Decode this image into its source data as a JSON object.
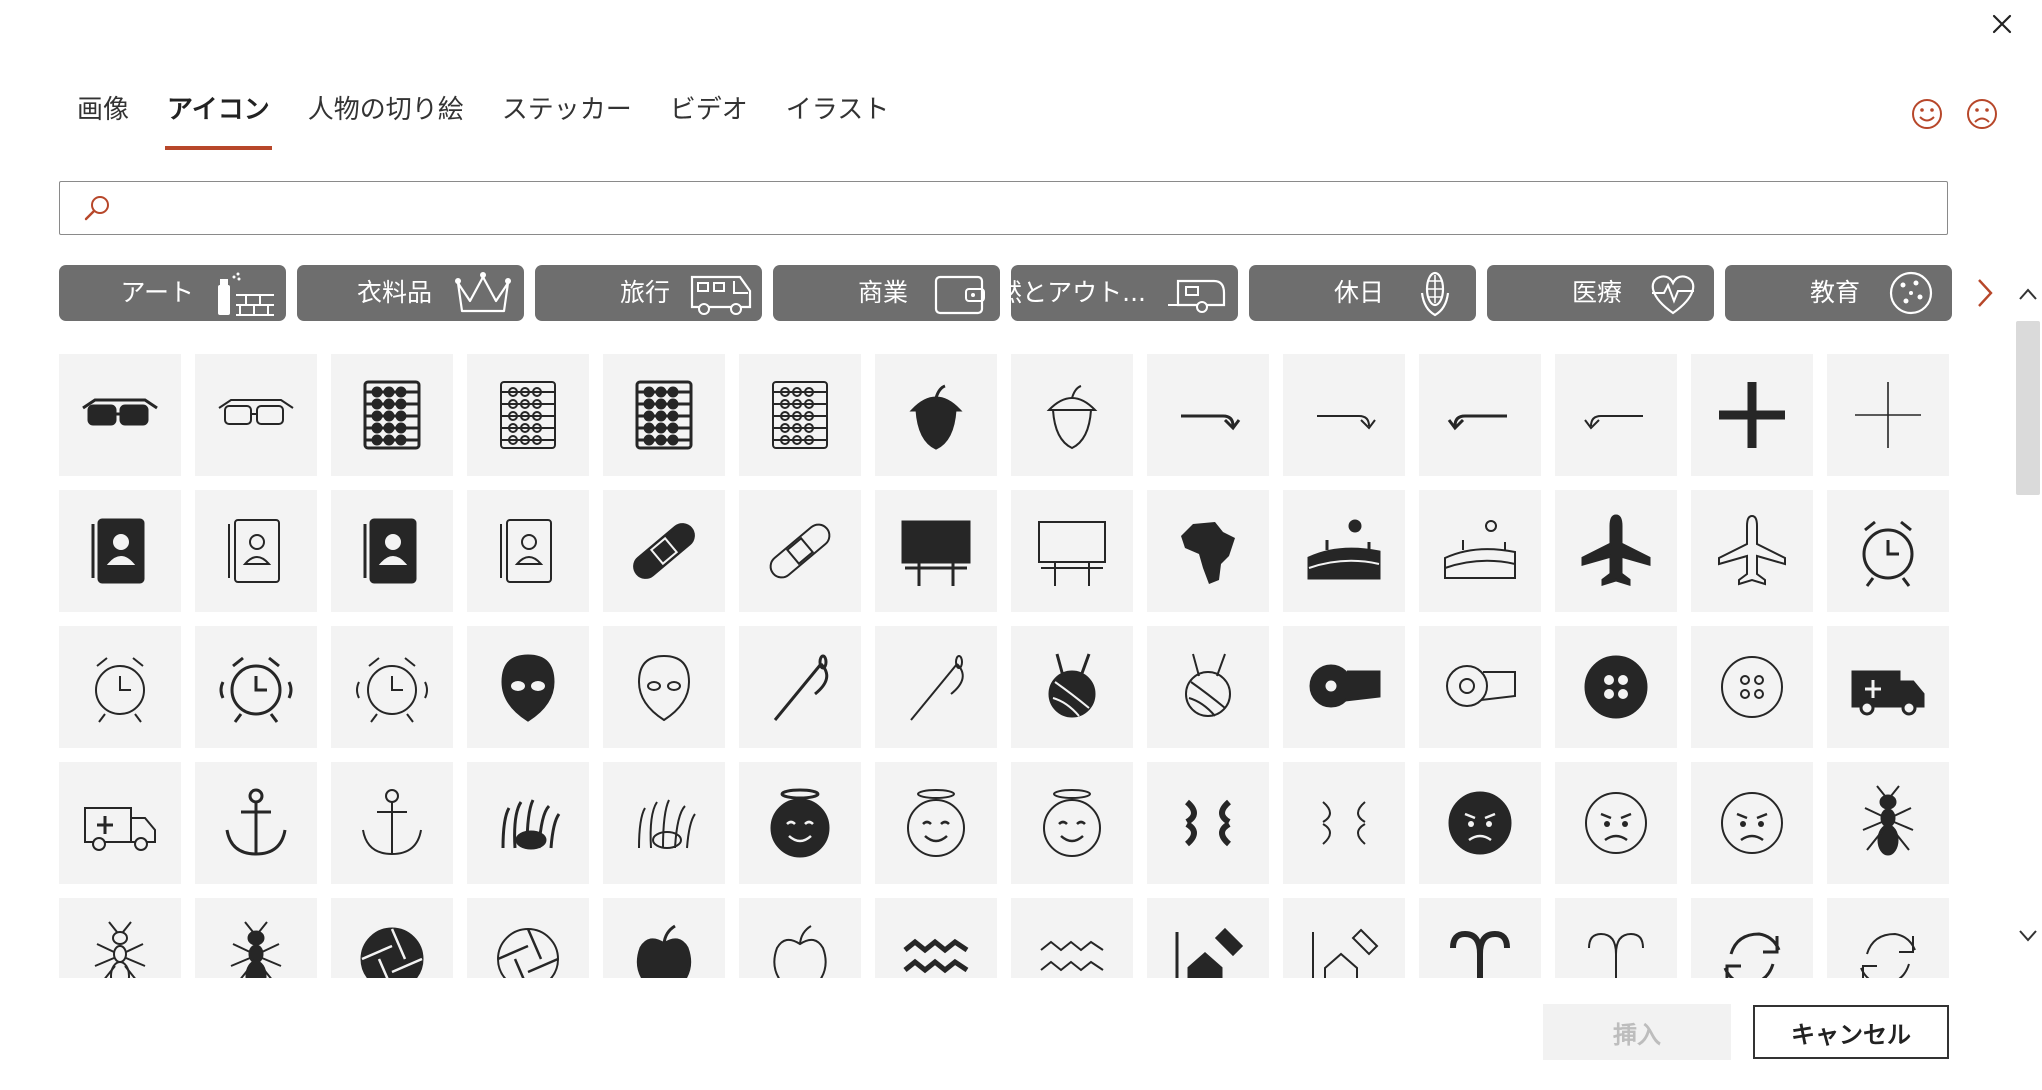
{
  "tabs": [
    {
      "label": "画像"
    },
    {
      "label": "アイコン"
    },
    {
      "label": "人物の切り絵"
    },
    {
      "label": "ステッカー"
    },
    {
      "label": "ビデオ"
    },
    {
      "label": "イラスト"
    }
  ],
  "active_tab": "アイコン",
  "search": {
    "value": "",
    "icon": "search-icon"
  },
  "feedback": {
    "smile_icon": "smile-icon",
    "frown_icon": "frown-icon"
  },
  "categories": [
    {
      "label": "アート",
      "icon": "spray-paint-brick-icon"
    },
    {
      "label": "衣料品",
      "icon": "crown-icon"
    },
    {
      "label": "旅行",
      "icon": "rv-camper-icon"
    },
    {
      "label": "商業",
      "icon": "wallet-icon"
    },
    {
      "label": "自然とアウト...",
      "icon": "camping-trailer-icon"
    },
    {
      "label": "休日",
      "icon": "corn-icon"
    },
    {
      "label": "医療",
      "icon": "heart-pulse-icon"
    },
    {
      "label": "教育",
      "icon": "cookie-icon"
    }
  ],
  "icon_grid": [
    [
      "3d-glasses-icon",
      "3d-glasses-outline-icon",
      "abacus-icon",
      "abacus-outline-icon",
      "abacus-filled-icon",
      "abacus-frame-icon",
      "acorn-icon",
      "acorn-outline-icon",
      "arrow-right-curve-icon",
      "arrow-right-curve-outline-icon",
      "arrow-left-curve-icon",
      "arrow-left-curve-outline-icon",
      "plus-bold-icon",
      "plus-thin-icon"
    ],
    [
      "address-book-icon",
      "address-book-outline-icon",
      "address-book-alt-icon",
      "address-book-alt-outline-icon",
      "bandage-icon",
      "bandage-outline-icon",
      "billboard-icon",
      "billboard-outline-icon",
      "africa-icon",
      "farm-landscape-icon",
      "farm-landscape-outline-icon",
      "airplane-icon",
      "airplane-outline-icon",
      "alarm-clock-icon"
    ],
    [
      "alarm-clock-outline-icon",
      "alarm-ringing-icon",
      "alarm-ringing-outline-icon",
      "alien-icon",
      "alien-outline-icon",
      "needle-thread-icon",
      "needle-thread-outline-icon",
      "yarn-ball-icon",
      "yarn-ball-outline-icon",
      "measuring-tape-icon",
      "measuring-tape-outline-icon",
      "button-icon",
      "button-outline-icon",
      "ambulance-icon"
    ],
    [
      "ambulance-outline-icon",
      "anchor-icon",
      "anchor-outline-icon",
      "anemone-fish-icon",
      "anemone-fish-outline-icon",
      "angel-face-icon",
      "angel-face-outline-icon",
      "angel-face-outline-bold-icon",
      "anger-symbol-icon",
      "anger-symbol-outline-icon",
      "angry-face-icon",
      "angry-face-outline-icon",
      "angry-face-outline-bold-icon",
      "ant-icon"
    ],
    [
      "ant-outline-icon",
      "antarctica-icon",
      "aperture-icon",
      "aperture-outline-icon",
      "apple-icon",
      "apple-outline-icon",
      "aquarius-icon",
      "aquarius-outline-icon",
      "architecture-icon",
      "architecture-outline-icon",
      "aries-icon",
      "aries-outline-icon",
      "refresh-icon",
      "refresh-outline-icon"
    ]
  ],
  "scrollbar": {
    "up_icon": "chevron-up-icon",
    "down_icon": "chevron-down-icon"
  },
  "buttons": {
    "insert": "挿入",
    "cancel": "キャンセル"
  },
  "colors": {
    "accent": "#b7472a",
    "chip_bg": "#6e6e6e",
    "cell_bg": "#f3f3f3",
    "icon": "#262626"
  }
}
